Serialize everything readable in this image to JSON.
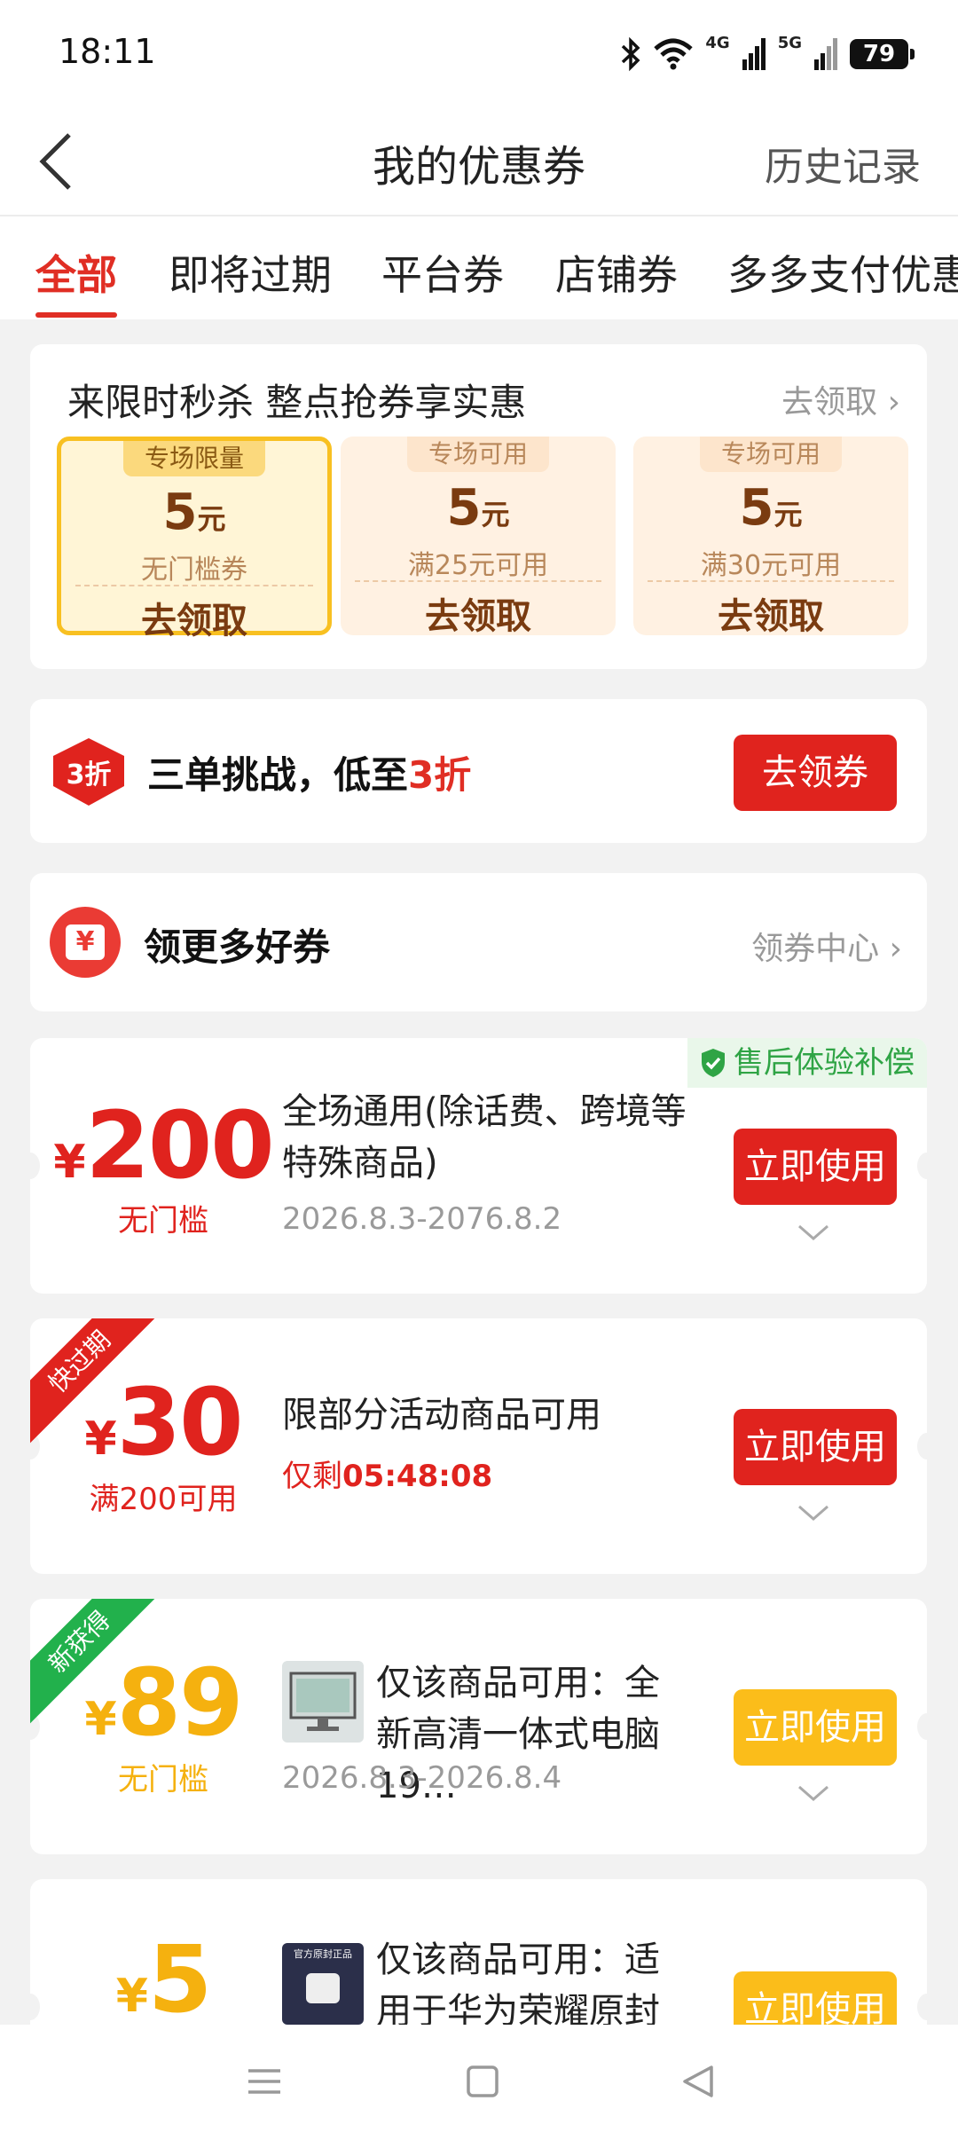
{
  "status": {
    "time": "18:11",
    "battery": "79",
    "net1": "4G",
    "net2": "5G"
  },
  "header": {
    "title": "我的优惠券",
    "history": "历史记录"
  },
  "tabs": [
    "全部",
    "即将过期",
    "平台券",
    "店铺券",
    "多多支付优惠"
  ],
  "flash": {
    "title": "来限时秒杀 整点抢券享实惠",
    "link": "去领取",
    "coupons": [
      {
        "tag": "专场限量",
        "amount": "5",
        "unit": "元",
        "cond": "无门槛券",
        "btn": "去领取"
      },
      {
        "tag": "专场可用",
        "amount": "5",
        "unit": "元",
        "cond": "满25元可用",
        "btn": "去领取"
      },
      {
        "tag": "专场可用",
        "amount": "5",
        "unit": "元",
        "cond": "满30元可用",
        "btn": "去领取"
      }
    ]
  },
  "promo": {
    "badge": "3折",
    "text_a": "三单挑战，低至",
    "text_b": "3折",
    "btn": "去领券"
  },
  "more": {
    "icon_text": "¥",
    "text": "领更多好券",
    "link": "领券中心"
  },
  "coupons": [
    {
      "currency": "¥",
      "amount": "200",
      "cond": "无门槛",
      "desc": "全场通用(除话费、跨境等特殊商品)",
      "date": "2026.8.3-2076.8.2",
      "btn": "立即使用",
      "badge": "售后体验补偿"
    },
    {
      "currency": "¥",
      "amount": "30",
      "cond": "满200可用",
      "desc": "限部分活动商品可用",
      "countdown_label": "仅剩",
      "countdown": "05:48:08",
      "btn": "立即使用",
      "ribbon": "快过期"
    },
    {
      "currency": "¥",
      "amount": "89",
      "cond": "无门槛",
      "desc": "仅该商品可用：全新高清一体式电脑19…",
      "date": "2026.8.3-2026.8.4",
      "btn": "立即使用",
      "ribbon": "新获得"
    },
    {
      "currency": "¥",
      "amount": "5",
      "desc": "仅该商品可用：适用于华为荣耀原封数…",
      "btn": "立即使用",
      "thumb_text": "官方原封正品"
    }
  ],
  "colors": {
    "red": "#e0231e",
    "yellow": "#fbbd1a",
    "green": "#2fa445",
    "accent_text": "#e02e24"
  }
}
